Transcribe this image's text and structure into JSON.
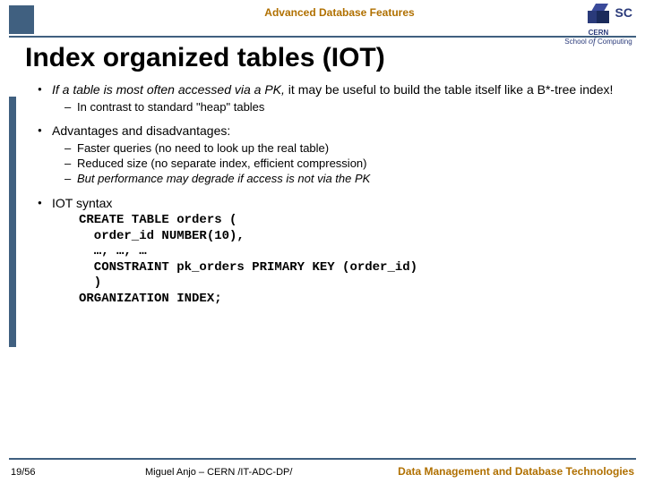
{
  "header": {
    "topic": "Advanced Database Features",
    "logo_org": "CERN",
    "logo_sc": "SC",
    "logo_school": "School",
    "logo_of": "of",
    "logo_computing": "Computing"
  },
  "title": "Index organized tables (IOT)",
  "bullets": {
    "b1": {
      "lead_italic": "If a table is most often accessed via a PK,",
      "lead_rest": " it may be useful to build the table itself like a B*-tree index!",
      "sub1": "In contrast to standard \"heap\" tables"
    },
    "b2": {
      "head": "Advantages and disadvantages:",
      "s1": "Faster queries (no need to look up the real table)",
      "s2": "Reduced size (no separate index, efficient compression)",
      "s3": "But performance may degrade if access is not via the PK"
    },
    "b3": {
      "head": "IOT syntax",
      "code": "CREATE TABLE orders (\n  order_id NUMBER(10),\n  …, …, …\n  CONSTRAINT pk_orders PRIMARY KEY (order_id)\n  )\nORGANIZATION INDEX;"
    }
  },
  "footer": {
    "page": "19/56",
    "author": "Miguel Anjo – CERN /IT-ADC-DP/",
    "course": "Data Management and Database Technologies"
  }
}
